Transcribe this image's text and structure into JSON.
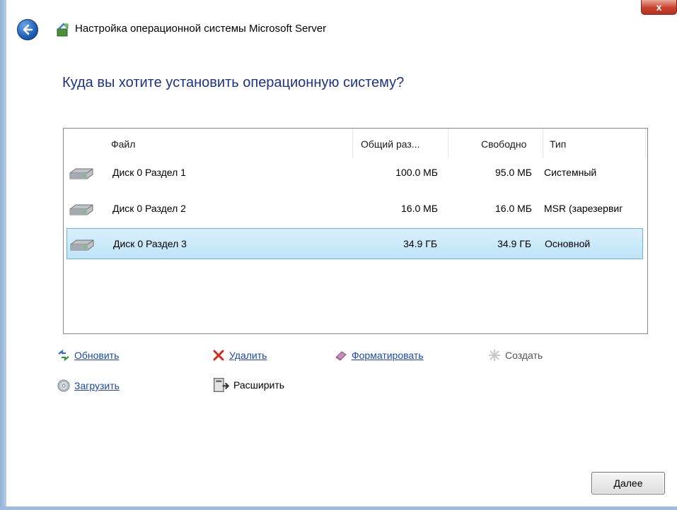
{
  "window": {
    "title": "Настройка операционной системы Microsoft Server",
    "close_label": "x"
  },
  "heading": "Куда вы хотите установить операционную систему?",
  "table": {
    "columns": [
      "Файл",
      "Общий раз...",
      "Свободно",
      "Тип"
    ],
    "rows": [
      {
        "name": "Диск 0 Раздел 1",
        "total": "100.0 МБ",
        "free": "95.0 МБ",
        "type": "Системный"
      },
      {
        "name": "Диск 0 Раздел 2",
        "total": "16.0 МБ",
        "free": "16.0 МБ",
        "type": "MSR (зарезервиг"
      },
      {
        "name": "Диск 0 Раздел 3",
        "total": "34.9 ГБ",
        "free": "34.9 ГБ",
        "type": "Основной"
      }
    ],
    "selected_row": 2
  },
  "actions": {
    "refresh": "Обновить",
    "delete": "Удалить",
    "format": "Форматировать",
    "create": "Создать",
    "load": "Загрузить",
    "extend": "Расширить"
  },
  "next_label": "Далее",
  "colors": {
    "heading": "#1e3287",
    "link": "#1c48a8",
    "selection": "#bfe4f9"
  }
}
